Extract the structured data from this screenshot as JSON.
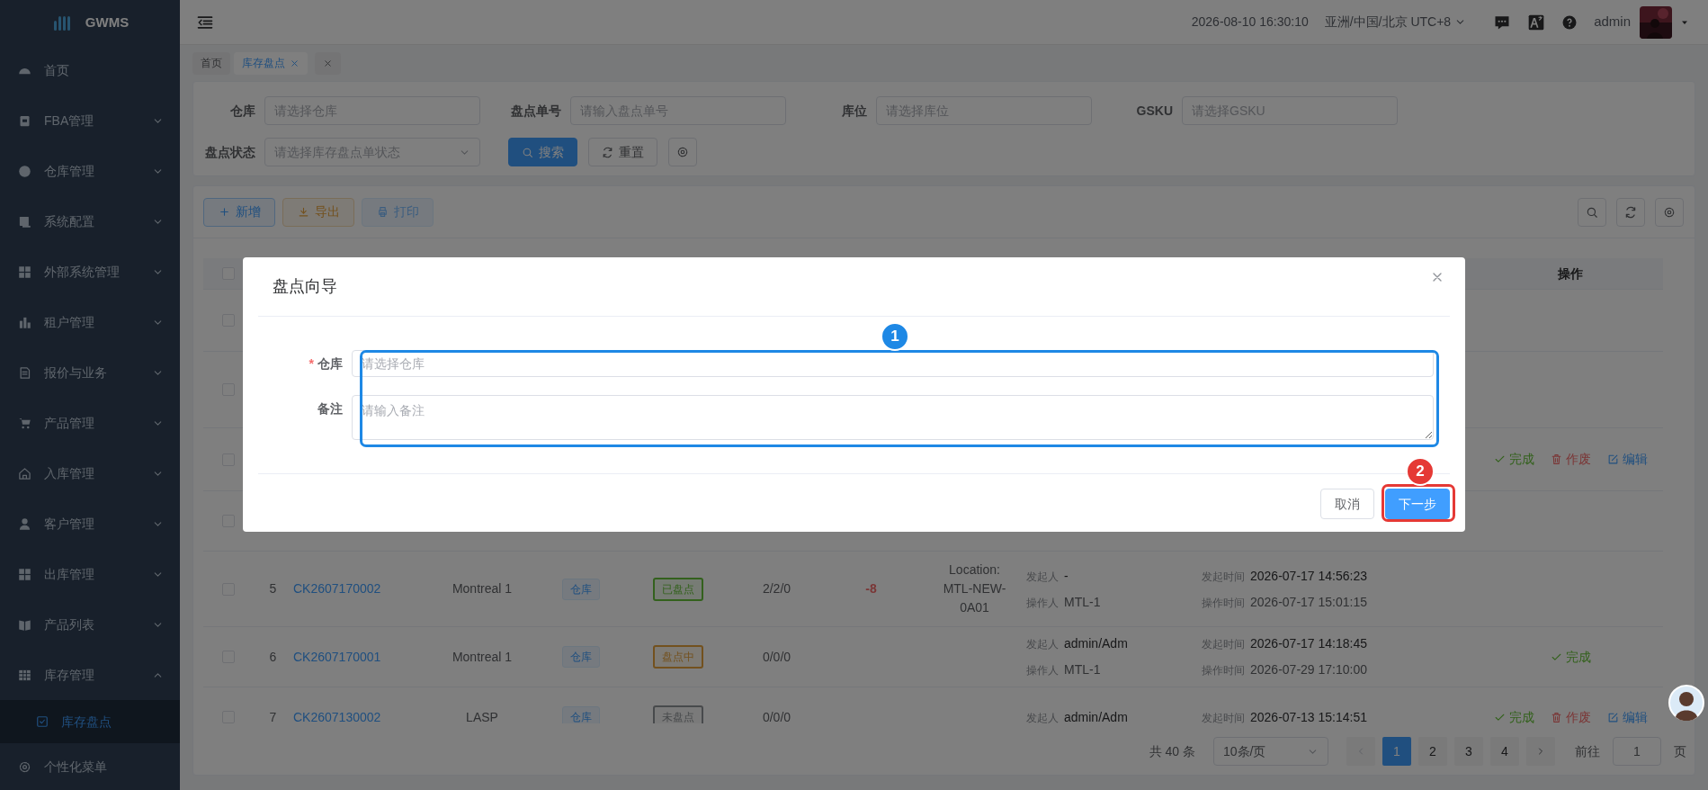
{
  "brand": {
    "name": "GWMS"
  },
  "sidebar": {
    "items": [
      {
        "label": "首页",
        "selected": false
      },
      {
        "label": "FBA管理",
        "selected": false,
        "expanded": false
      },
      {
        "label": "仓库管理",
        "selected": false,
        "expanded": false
      },
      {
        "label": "系统配置",
        "selected": false,
        "expanded": false
      },
      {
        "label": "外部系统管理",
        "selected": false,
        "expanded": false
      },
      {
        "label": "租户管理",
        "selected": false,
        "expanded": false
      },
      {
        "label": "报价与业务",
        "selected": false,
        "expanded": false
      },
      {
        "label": "产品管理",
        "selected": false,
        "expanded": false
      },
      {
        "label": "入库管理",
        "selected": false,
        "expanded": false
      },
      {
        "label": "客户管理",
        "selected": false,
        "expanded": false
      },
      {
        "label": "出库管理",
        "selected": false,
        "expanded": false
      },
      {
        "label": "产品列表",
        "selected": false,
        "expanded": false
      },
      {
        "label": "库存管理",
        "selected": false,
        "expanded": true,
        "children": [
          {
            "label": "库存盘点",
            "selected": true
          }
        ]
      },
      {
        "label": "个性化菜单",
        "selected": false
      }
    ]
  },
  "header": {
    "datetime": "2026-08-10 16:30:10",
    "timezone": "亚洲/中国/北京 UTC+8",
    "user": "admin"
  },
  "tabs": [
    {
      "label": "首页",
      "selected": false,
      "closable": false
    },
    {
      "label": "库存盘点",
      "selected": true,
      "closable": true
    }
  ],
  "filters": [
    {
      "label": "仓库",
      "placeholder": "请选择仓库",
      "kind": "input"
    },
    {
      "label": "盘点单号",
      "placeholder": "请输入盘点单号",
      "kind": "input"
    },
    {
      "label": "库位",
      "placeholder": "请选择库位",
      "kind": "input"
    },
    {
      "label": "GSKU",
      "placeholder": "请选择GSKU",
      "kind": "input"
    },
    {
      "label": "盘点状态",
      "placeholder": "请选择库存盘点单状态",
      "kind": "select"
    }
  ],
  "filter_buttons": [
    {
      "label": "搜索",
      "kind": "search"
    },
    {
      "label": "重置",
      "kind": "reset"
    }
  ],
  "toolbar": [
    {
      "label": "新增",
      "kind": "add",
      "disabled": false
    },
    {
      "label": "导出",
      "kind": "export",
      "disabled": false
    },
    {
      "label": "打印",
      "kind": "print",
      "disabled": true
    }
  ],
  "table": {
    "all_selected": false,
    "action_column": "操作",
    "rows": [
      {
        "selected": false
      },
      {
        "selected": false
      },
      {
        "selected": false,
        "actions": [
          {
            "label": "完成",
            "kind": "complete"
          },
          {
            "label": "作废",
            "kind": "void"
          },
          {
            "label": "编辑",
            "kind": "edit"
          }
        ]
      },
      {
        "selected": false
      },
      {
        "selected": false,
        "index": "5",
        "number": "CK2607170002",
        "warehouse": "Montreal 1",
        "type": "仓库",
        "status": {
          "label": "已盘点",
          "color": "#33611d"
        },
        "counts": "2/2/0",
        "difference": "-8",
        "location": "Location: MTL-NEW-0A01",
        "initiator_label": "发起人",
        "initiator": "-",
        "operator_label": "操作人",
        "operator": "MTL-1",
        "initiated_label": "发起时间",
        "initiated_at": "2026-07-17 14:56:23",
        "operated_label": "操作时间",
        "operated_at": "2026-07-17 15:01:15"
      },
      {
        "selected": false,
        "index": "6",
        "number": "CK2607170001",
        "warehouse": "Montreal 1",
        "type": "仓库",
        "status": {
          "label": "盘点中",
          "color": "#73511e"
        },
        "counts": "0/0/0",
        "initiator_label": "发起人",
        "initiator": "admin/Adm",
        "operator_label": "操作人",
        "operator": "MTL-1",
        "initiated_label": "发起时间",
        "initiated_at": "2026-07-17 14:18:45",
        "operated_label": "操作时间",
        "operated_at": "2026-07-29 17:10:00",
        "actions": [
          {
            "label": "完成",
            "kind": "complete"
          }
        ]
      },
      {
        "selected": false,
        "index": "7",
        "number": "CK2607130002",
        "warehouse": "LASP",
        "type": "仓库",
        "status": {
          "label": "未盘点",
          "color": "#484a4c"
        },
        "counts": "0/0/0",
        "initiator_label": "发起人",
        "initiator": "admin/Adm",
        "initiated_label": "发起时间",
        "initiated_at": "2026-07-13 15:14:51",
        "actions": [
          {
            "label": "完成",
            "kind": "complete"
          },
          {
            "label": "作废",
            "kind": "void"
          },
          {
            "label": "编辑",
            "kind": "edit"
          }
        ]
      }
    ]
  },
  "pagination": {
    "total": "共 40 条",
    "page_size": "10条/页",
    "pages": [
      {
        "label": "1",
        "selected": true
      },
      {
        "label": "2",
        "selected": false
      },
      {
        "label": "3",
        "selected": false
      },
      {
        "label": "4",
        "selected": false
      }
    ],
    "goto_label": "前往",
    "goto_value": "1",
    "page_unit": "页"
  },
  "modal": {
    "title": "盘点向导",
    "fields": [
      {
        "label": "仓库",
        "required_mark": "*",
        "placeholder": "请选择仓库",
        "kind": "select"
      },
      {
        "label": "备注",
        "placeholder": "请输入备注",
        "kind": "textarea"
      }
    ],
    "buttons": [
      {
        "label": "取消",
        "primary": false
      },
      {
        "label": "下一步",
        "primary": true
      }
    ]
  },
  "annotations": [
    {
      "label": "1",
      "color": "#1e88e5"
    },
    {
      "label": "2",
      "color": "#e53935"
    }
  ]
}
